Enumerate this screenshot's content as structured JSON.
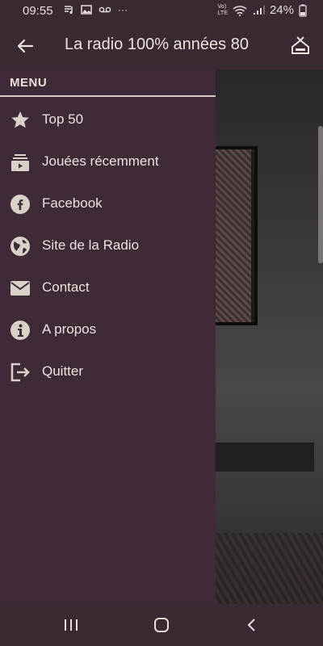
{
  "status_bar": {
    "time": "09:55",
    "battery": "24%",
    "net_top": "Vo)",
    "net_bottom": "LTE"
  },
  "app_bar": {
    "title": "La radio 100% années 80"
  },
  "drawer": {
    "header": "MENU",
    "items": [
      {
        "label": "Top 50",
        "icon": "star-icon"
      },
      {
        "label": "Jouées récemment",
        "icon": "playlist-icon"
      },
      {
        "label": "Facebook",
        "icon": "facebook-icon"
      },
      {
        "label": "Site de la Radio",
        "icon": "globe-icon"
      },
      {
        "label": "Contact",
        "icon": "mail-icon"
      },
      {
        "label": "A propos",
        "icon": "info-icon"
      },
      {
        "label": "Quitter",
        "icon": "exit-icon"
      }
    ]
  },
  "colors": {
    "bar": "#3a2a34",
    "drawer": "#3f2b37",
    "text": "#ece4dc",
    "icon": "#d9d0c7"
  }
}
